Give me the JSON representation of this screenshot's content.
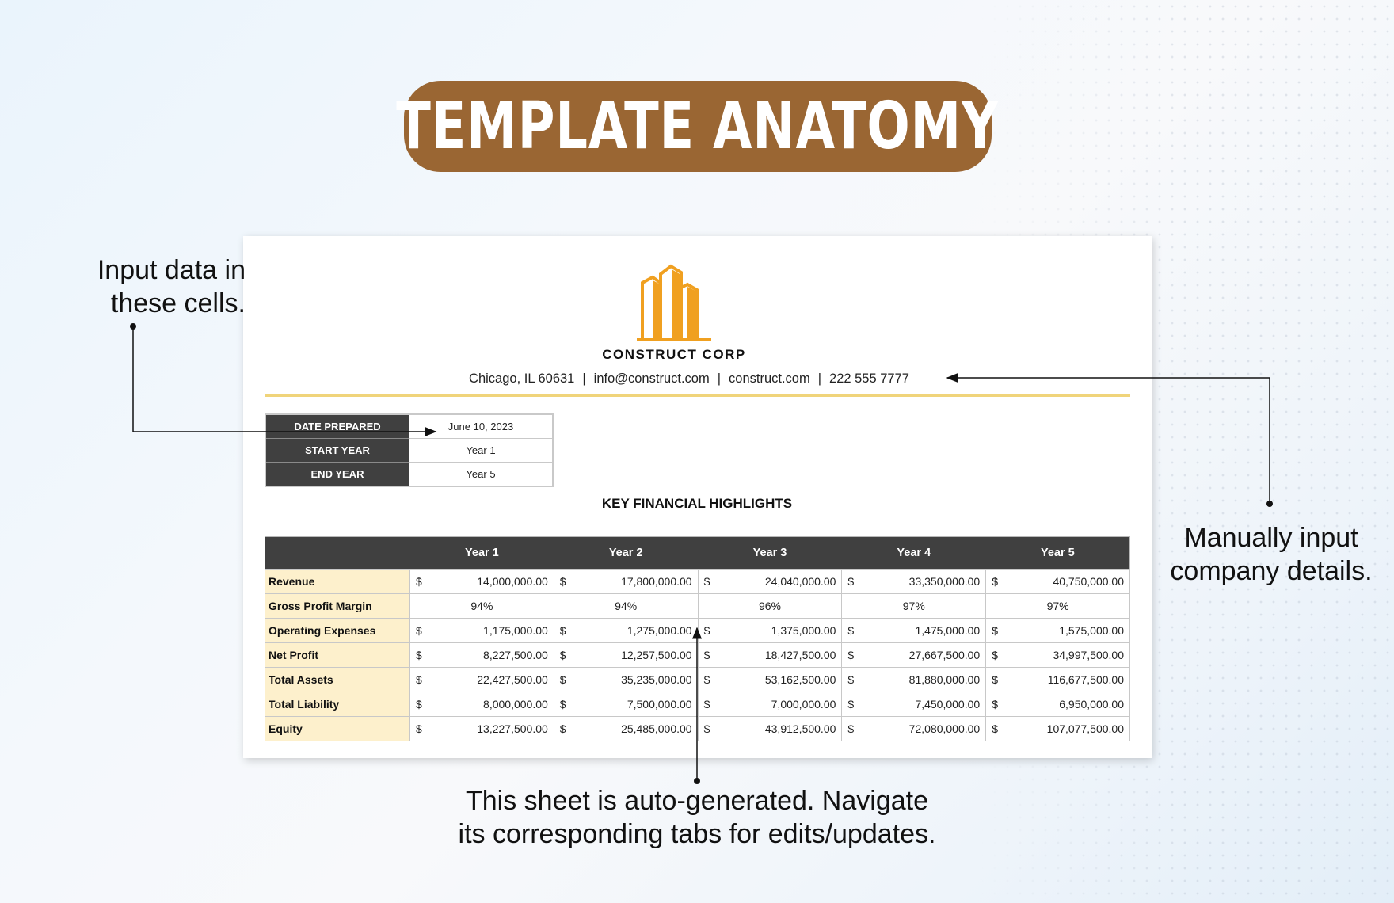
{
  "header": {
    "title": "TEMPLATE ANATOMY",
    "title_bg_color": "#9a6633"
  },
  "company": {
    "logo_icon": "buildings-icon",
    "logo_color": "#f0a020",
    "name": "CONSTRUCT CORP",
    "contact": {
      "address": "Chicago, IL 60631",
      "email": "info@construct.com",
      "website": "construct.com",
      "phone": "222 555 7777",
      "separator": "|"
    }
  },
  "info": {
    "rows": [
      {
        "label": "DATE PREPARED",
        "value": "June 10, 2023"
      },
      {
        "label": "START YEAR",
        "value": "Year 1"
      },
      {
        "label": "END YEAR",
        "value": "Year 5"
      }
    ]
  },
  "highlights": {
    "title": "KEY FINANCIAL HIGHLIGHTS",
    "columns": [
      "",
      "Year 1",
      "Year 2",
      "Year 3",
      "Year 4",
      "Year 5"
    ],
    "currency_symbol": "$",
    "rows": [
      {
        "label": "Revenue",
        "type": "currency",
        "values": [
          "14,000,000.00",
          "17,800,000.00",
          "24,040,000.00",
          "33,350,000.00",
          "40,750,000.00"
        ]
      },
      {
        "label": "Gross Profit Margin",
        "type": "percent",
        "values": [
          "94%",
          "94%",
          "96%",
          "97%",
          "97%"
        ]
      },
      {
        "label": "Operating Expenses",
        "type": "currency",
        "values": [
          "1,175,000.00",
          "1,275,000.00",
          "1,375,000.00",
          "1,475,000.00",
          "1,575,000.00"
        ]
      },
      {
        "label": "Net Profit",
        "type": "currency",
        "values": [
          "8,227,500.00",
          "12,257,500.00",
          "18,427,500.00",
          "27,667,500.00",
          "34,997,500.00"
        ]
      },
      {
        "label": "Total Assets",
        "type": "currency",
        "values": [
          "22,427,500.00",
          "35,235,000.00",
          "53,162,500.00",
          "81,880,000.00",
          "116,677,500.00"
        ]
      },
      {
        "label": "Total Liability",
        "type": "currency",
        "values": [
          "8,000,000.00",
          "7,500,000.00",
          "7,000,000.00",
          "7,450,000.00",
          "6,950,000.00"
        ]
      },
      {
        "label": "Equity",
        "type": "currency",
        "values": [
          "13,227,500.00",
          "25,485,000.00",
          "43,912,500.00",
          "72,080,000.00",
          "107,077,500.00"
        ]
      }
    ]
  },
  "annotations": {
    "left": [
      "Input data in",
      "these cells."
    ],
    "right": [
      "Manually input",
      "company details."
    ],
    "bottom": [
      "This sheet is auto-generated. Navigate",
      "its corresponding tabs for edits/updates."
    ]
  }
}
